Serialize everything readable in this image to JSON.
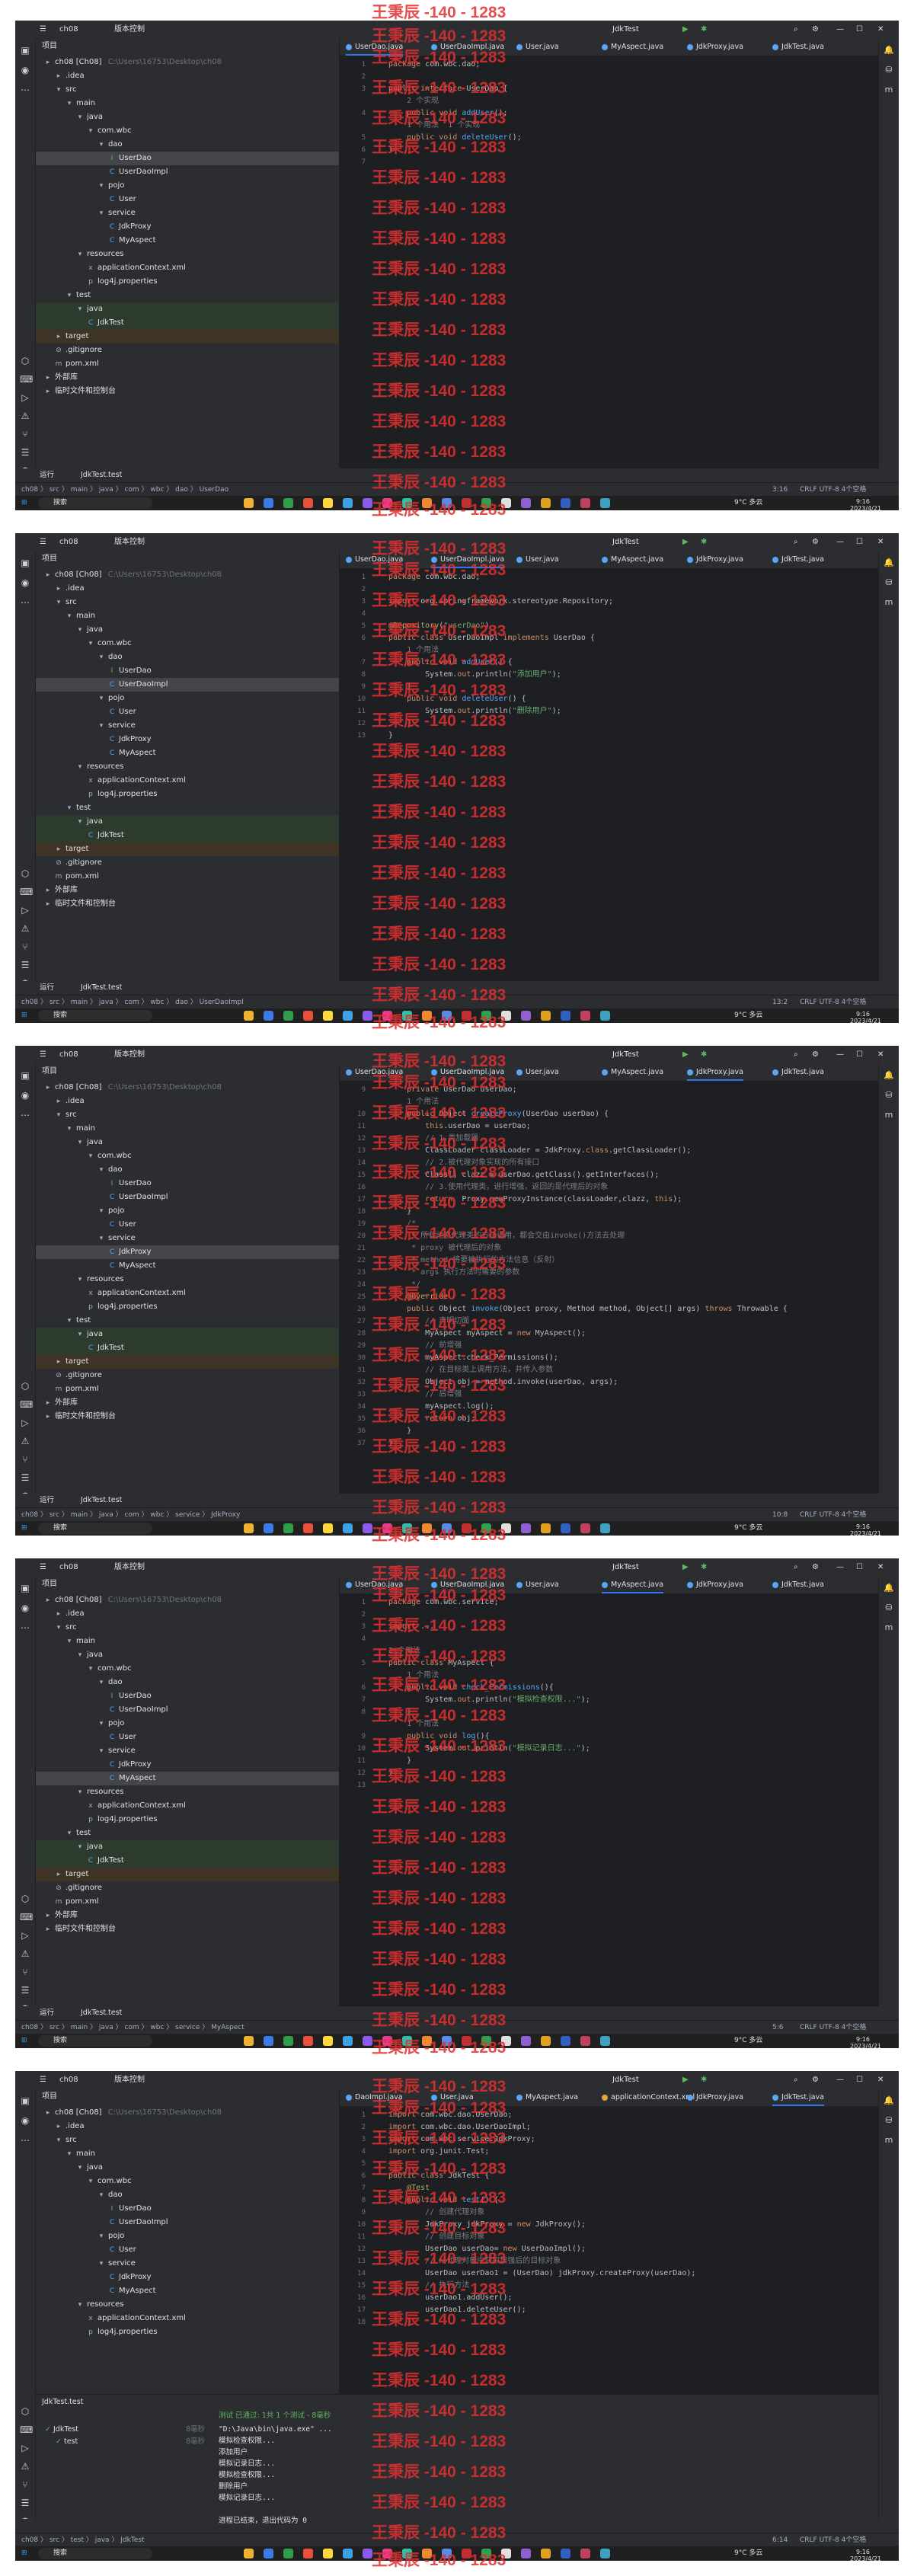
{
  "watermark": "王秉辰 -140 - 1283",
  "project_name": "ch08",
  "vcs_label": "版本控制",
  "run_config": "JdkTest",
  "project_panel_title": "项目",
  "project_root": "ch08 [Ch08]",
  "project_path": "C:\\Users\\16753\\Desktop\\ch08",
  "tree": [
    "ch08 [Ch08]",
    ".idea",
    "src",
    "main",
    "java",
    "com.wbc",
    "dao",
    "UserDao",
    "UserDaoImpl",
    "pojo",
    "User",
    "service",
    "JdkProxy",
    "MyAspect",
    "resources",
    "applicationContext.xml",
    "log4j.properties",
    "test",
    "java",
    "JdkTest",
    "target",
    ".gitignore",
    "pom.xml",
    "外部库",
    "临时文件和控制台"
  ],
  "taskbar": {
    "search": "搜索",
    "weather": "9°C 多云",
    "time": "9:16",
    "date": "2023/4/21"
  },
  "bottom_tab": "JdkTest.test",
  "run_title": "运行",
  "shots": [
    {
      "tabs": [
        "UserDao.java",
        "UserDaoImpl.java",
        "User.java",
        "MyAspect.java",
        "JdkProxy.java",
        "JdkTest.java"
      ],
      "active_tab": "UserDao.java",
      "breadcrumb": "ch08 〉 src 〉 main 〉 java 〉 com 〉 wbc 〉 dao 〉 UserDao",
      "cursor": "3:16",
      "selected": "UserDao",
      "lines": [
        {
          "n": "1",
          "html": "<span class=\"kw\">package</span> com.wbc.dao;"
        },
        {
          "n": "2",
          "html": ""
        },
        {
          "n": "3",
          "html": "<span class=\"kw\">public interface</span> UserDao {"
        },
        {
          "n": "",
          "html": "<span class=\"cm\">    2 个实现</span>"
        },
        {
          "n": "4",
          "html": "    <span class=\"kw\">public void</span> <span class=\"fn\">addUser</span>();"
        },
        {
          "n": "",
          "html": "<span class=\"cm\">    1 个用法  1 个实现</span>"
        },
        {
          "n": "5",
          "html": "    <span class=\"kw\">public void</span> <span class=\"fn\">deleteUser</span>();"
        },
        {
          "n": "6",
          "html": "}"
        },
        {
          "n": "7",
          "html": ""
        }
      ]
    },
    {
      "tabs": [
        "UserDao.java",
        "UserDaoImpl.java",
        "User.java",
        "MyAspect.java",
        "JdkProxy.java",
        "JdkTest.java"
      ],
      "active_tab": "UserDaoImpl.java",
      "breadcrumb": "ch08 〉 src 〉 main 〉 java 〉 com 〉 wbc 〉 dao 〉 UserDaoImpl",
      "cursor": "13:2",
      "selected": "UserDaoImpl",
      "lines": [
        {
          "n": "1",
          "html": "<span class=\"kw\">package</span> com.wbc.dao;"
        },
        {
          "n": "2",
          "html": ""
        },
        {
          "n": "3",
          "html": "<span class=\"kw\">import</span> org.springframework.stereotype.Repository;"
        },
        {
          "n": "4",
          "html": ""
        },
        {
          "n": "5",
          "html": "<span class=\"an\">@Repository</span>(<span class=\"st\">\"userDao\"</span>)"
        },
        {
          "n": "6",
          "html": "<span class=\"kw\">public class</span> UserDaoImpl <span class=\"kw\">implements</span> UserDao {"
        },
        {
          "n": "",
          "html": "<span class=\"cm\">    1 个用法</span>"
        },
        {
          "n": "7",
          "html": "    <span class=\"kw\">public void</span> <span class=\"fn\">addUser</span>() {"
        },
        {
          "n": "8",
          "html": "        System.<span class=\"kw\">out</span>.println(<span class=\"st\">\"添加用户\"</span>);"
        },
        {
          "n": "9",
          "html": "    }"
        },
        {
          "n": "10",
          "html": "    <span class=\"kw\">public void</span> <span class=\"fn\">deleteUser</span>() {"
        },
        {
          "n": "11",
          "html": "        System.<span class=\"kw\">out</span>.println(<span class=\"st\">\"删除用户\"</span>);"
        },
        {
          "n": "12",
          "html": "    }"
        },
        {
          "n": "13",
          "html": "}"
        }
      ]
    },
    {
      "tabs": [
        "UserDao.java",
        "UserDaoImpl.java",
        "User.java",
        "MyAspect.java",
        "JdkProxy.java",
        "JdkTest.java"
      ],
      "active_tab": "JdkProxy.java",
      "breadcrumb": "ch08 〉 src 〉 main 〉 java 〉 com 〉 wbc 〉 service 〉 JdkProxy",
      "cursor": "10:8",
      "selected": "JdkProxy",
      "lines": [
        {
          "n": "9",
          "html": "    <span class=\"kw\">private</span> UserDao userDao;"
        },
        {
          "n": "",
          "html": "<span class=\"cm\">    1 个用法</span>"
        },
        {
          "n": "10",
          "html": "    <span class=\"kw\">public</span> Object <span class=\"fn\">createProxy</span>(UserDao userDao) {"
        },
        {
          "n": "11",
          "html": "        <span class=\"kw\">this</span>.userDao = userDao;"
        },
        {
          "n": "12",
          "html": "<span class=\"cm\">        // 1.类加载器</span>"
        },
        {
          "n": "13",
          "html": "        ClassLoader classLoader = JdkProxy.<span class=\"kw\">class</span>.getClassLoader();"
        },
        {
          "n": "14",
          "html": "<span class=\"cm\">        // 2.被代理对象实现的所有接口</span>"
        },
        {
          "n": "15",
          "html": "        Class[] clazz = userDao.getClass().getInterfaces();"
        },
        {
          "n": "16",
          "html": "<span class=\"cm\">        // 3.使用代理类，进行增强，返回的是代理后的对象</span>"
        },
        {
          "n": "17",
          "html": "        <span class=\"kw\">return</span>  Proxy.newProxyInstance(classLoader,clazz, <span class=\"kw\">this</span>);"
        },
        {
          "n": "18",
          "html": "    }"
        },
        {
          "n": "19",
          "html": "<span class=\"cm\">    /*</span>"
        },
        {
          "n": "20",
          "html": "<span class=\"cm\">     * 所有动态代理类的方法调用，都会交由invoke()方法去处理</span>"
        },
        {
          "n": "21",
          "html": "<span class=\"cm\">     * proxy 被代理后的对象</span>"
        },
        {
          "n": "22",
          "html": "<span class=\"cm\">     * method 将要被执行的方法信息（反射）</span>"
        },
        {
          "n": "23",
          "html": "<span class=\"cm\">     * args 执行方法时需要的参数</span>"
        },
        {
          "n": "24",
          "html": "<span class=\"cm\">     */</span>"
        },
        {
          "n": "25",
          "html": "    <span class=\"an\">@Override</span>"
        },
        {
          "n": "26",
          "html": "    <span class=\"kw\">public</span> Object <span class=\"fn\">invoke</span>(Object proxy, Method method, Object[] args) <span class=\"kw\">throws</span> Throwable {"
        },
        {
          "n": "27",
          "html": "<span class=\"cm\">        // 声明切面</span>"
        },
        {
          "n": "28",
          "html": "        MyAspect myAspect = <span class=\"kw\">new</span> MyAspect();"
        },
        {
          "n": "29",
          "html": "<span class=\"cm\">        // 前增强</span>"
        },
        {
          "n": "30",
          "html": "        myAspect.check_Permissions();"
        },
        {
          "n": "31",
          "html": "<span class=\"cm\">        // 在目标类上调用方法，并传入参数</span>"
        },
        {
          "n": "32",
          "html": "        Object obj = method.invoke(userDao, args);"
        },
        {
          "n": "33",
          "html": "<span class=\"cm\">        // 后增强</span>"
        },
        {
          "n": "34",
          "html": "        myAspect.log();"
        },
        {
          "n": "35",
          "html": "        <span class=\"kw\">return</span> obj;"
        },
        {
          "n": "36",
          "html": "    }"
        },
        {
          "n": "37",
          "html": "}"
        }
      ]
    },
    {
      "tabs": [
        "UserDao.java",
        "UserDaoImpl.java",
        "User.java",
        "MyAspect.java",
        "JdkProxy.java",
        "JdkTest.java"
      ],
      "active_tab": "MyAspect.java",
      "breadcrumb": "ch08 〉 src 〉 main 〉 java 〉 com 〉 wbc 〉 service 〉 MyAspect",
      "cursor": "5:6",
      "selected": "MyAspect",
      "lines": [
        {
          "n": "1",
          "html": "<span class=\"kw\">package</span> com.wbc.service;"
        },
        {
          "n": "2",
          "html": ""
        },
        {
          "n": "3",
          "html": "<span class=\"kw\">import</span> ..."
        },
        {
          "n": "4",
          "html": ""
        },
        {
          "n": "",
          "html": "<span class=\"cm\">2 个用法</span>"
        },
        {
          "n": "5",
          "html": "<span class=\"kw\">public class</span> MyAspect {"
        },
        {
          "n": "",
          "html": "<span class=\"cm\">    1 个用法</span>"
        },
        {
          "n": "6",
          "html": "    <span class=\"kw\">public void</span> <span class=\"fn\">check_Permissions</span>(){"
        },
        {
          "n": "7",
          "html": "        System.<span class=\"kw\">out</span>.println(<span class=\"st\">\"模拟检查权限...\"</span>);"
        },
        {
          "n": "8",
          "html": "    }"
        },
        {
          "n": "",
          "html": "<span class=\"cm\">    1 个用法</span>"
        },
        {
          "n": "9",
          "html": "    <span class=\"kw\">public void</span> <span class=\"fn\">log</span>(){"
        },
        {
          "n": "10",
          "html": "        System.<span class=\"kw\">out</span>.println(<span class=\"st\">\"模拟记录日志...\"</span>);"
        },
        {
          "n": "11",
          "html": "    }"
        },
        {
          "n": "12",
          "html": "}"
        },
        {
          "n": "13",
          "html": ""
        }
      ]
    },
    {
      "tabs": [
        "DaoImpl.java",
        "User.java",
        "MyAspect.java",
        "applicationContext.xml",
        "JdkProxy.java",
        "JdkTest.java"
      ],
      "active_tab": "JdkTest.java",
      "breadcrumb": "ch08 〉 src 〉 test 〉 java 〉 JdkTest",
      "cursor": "6:14",
      "selected": "",
      "lines": [
        {
          "n": "1",
          "html": "<span class=\"kw\">import</span> com.wbc.dao.UserDao;"
        },
        {
          "n": "2",
          "html": "<span class=\"kw\">import</span> com.wbc.dao.UserDaoImpl;"
        },
        {
          "n": "3",
          "html": "<span class=\"kw\">import</span> com.wbc.service.JdkProxy;"
        },
        {
          "n": "4",
          "html": "<span class=\"kw\">import</span> org.junit.Test;"
        },
        {
          "n": "5",
          "html": ""
        },
        {
          "n": "6",
          "html": "<span class=\"kw\">public class</span> JdkTest {"
        },
        {
          "n": "7",
          "html": "    <span class=\"an\">@Test</span>"
        },
        {
          "n": "8",
          "html": "    <span class=\"kw\">public void</span> <span class=\"fn\">test</span>() {"
        },
        {
          "n": "9",
          "html": "<span class=\"cm\">        // 创建代理对象</span>"
        },
        {
          "n": "10",
          "html": "        JdkProxy jdkProxy = <span class=\"kw\">new</span> JdkProxy();"
        },
        {
          "n": "11",
          "html": "<span class=\"cm\">        // 创建目标对象</span>"
        },
        {
          "n": "12",
          "html": "        UserDao userDao= <span class=\"kw\">new</span> UserDaoImpl();"
        },
        {
          "n": "13",
          "html": "<span class=\"cm\">        // 从代理对象中获取增强后的目标对象</span>"
        },
        {
          "n": "14",
          "html": "        UserDao userDao1 = (UserDao) jdkProxy.createProxy(userDao);"
        },
        {
          "n": "15",
          "html": "<span class=\"cm\">        // 执行方法</span>"
        },
        {
          "n": "16",
          "html": "        userDao1.addUser();"
        },
        {
          "n": "17",
          "html": "        userDao1.deleteUser();"
        },
        {
          "n": "18",
          "html": "    }"
        }
      ]
    }
  ],
  "run": {
    "status": "测试 已通过: 1共 1 个测试 - 8毫秒",
    "tree": [
      {
        "label": "JdkTest",
        "time": "8毫秒"
      },
      {
        "label": "test",
        "time": "8毫秒"
      }
    ],
    "output": [
      "\"D:\\Java\\bin\\java.exe\" ...",
      "模拟检查权限...",
      "添加用户",
      "模拟记录日志...",
      "模拟检查权限...",
      "删除用户",
      "模拟记录日志...",
      "",
      "进程已结束，退出代码为 0"
    ]
  },
  "colors": {
    "ide_bg": "#1e1f22",
    "panel": "#2b2d30",
    "accent": "#3574f0",
    "watermark": "#e03030"
  }
}
